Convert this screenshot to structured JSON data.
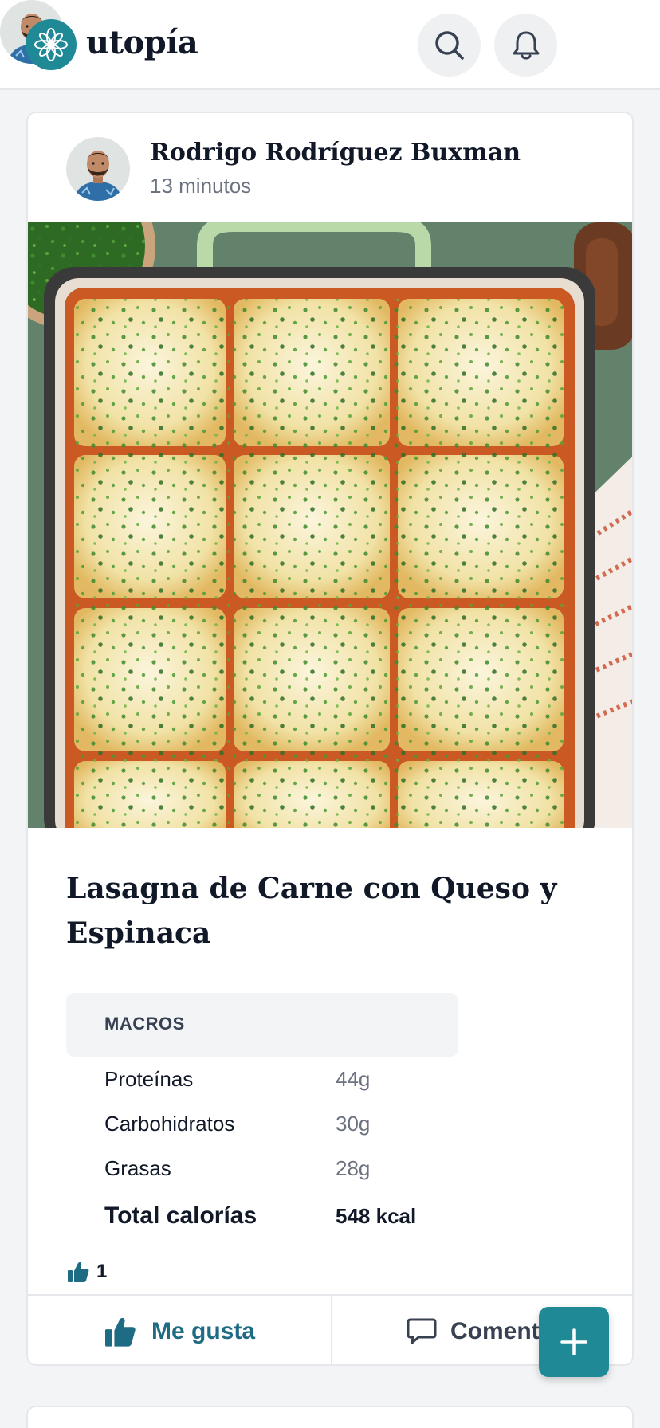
{
  "header": {
    "app_name": "utopía",
    "logo_icon": "flower-logo-icon",
    "search_icon": "search-icon",
    "notifications_icon": "bell-icon",
    "brand_color": "#1f8a96"
  },
  "post": {
    "author_name": "Rodrigo Rodríguez Buxman",
    "time_ago": "13 minutos",
    "recipe_title": "Lasagna de Carne con Queso y Espinaca",
    "macros": {
      "heading": "MACROS",
      "rows": [
        {
          "label": "Proteínas",
          "value": "44g"
        },
        {
          "label": "Carbohidratos",
          "value": "30g"
        },
        {
          "label": "Grasas",
          "value": "28g"
        }
      ],
      "total": {
        "label": "Total calorías",
        "value": "548 kcal"
      }
    },
    "likes_count": "1",
    "actions": {
      "like_label": "Me gusta",
      "comment_label": "Comentar",
      "like_color": "#1e6c83"
    }
  },
  "fab": {
    "icon": "plus-icon"
  }
}
